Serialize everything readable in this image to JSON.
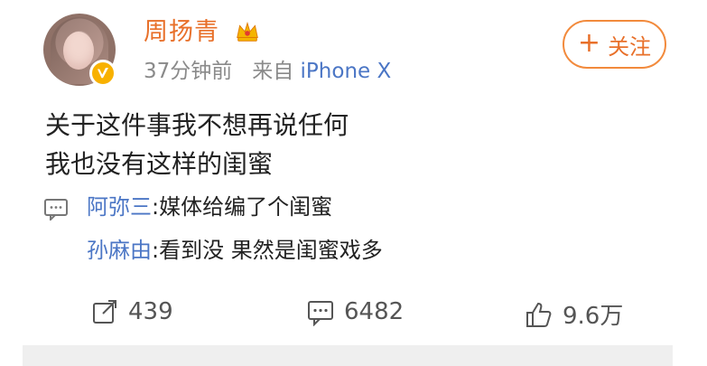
{
  "post": {
    "author": "周扬青",
    "time": "37分钟前",
    "source_prefix": "来自",
    "source": "iPhone X",
    "follow_label": "关注",
    "content_lines": [
      "关于这件事我不想再说任何",
      "我也没有这样的闺蜜"
    ],
    "comments": [
      {
        "user": "阿弥三",
        "text": ":媒体给编了个闺蜜"
      },
      {
        "user": "孙麻由",
        "text": ":看到没 果然是闺蜜戏多"
      }
    ],
    "actions": {
      "repost_count": "439",
      "comment_count": "6482",
      "like_count": "9.6万"
    }
  },
  "icons": {
    "verified": "v-badge-icon",
    "crown": "crown-icon",
    "repost": "share-icon",
    "comment": "comment-icon",
    "like": "thumbs-up-icon"
  },
  "colors": {
    "accent": "#e8702a",
    "link": "#4b76c5",
    "badge": "#f8b100"
  }
}
